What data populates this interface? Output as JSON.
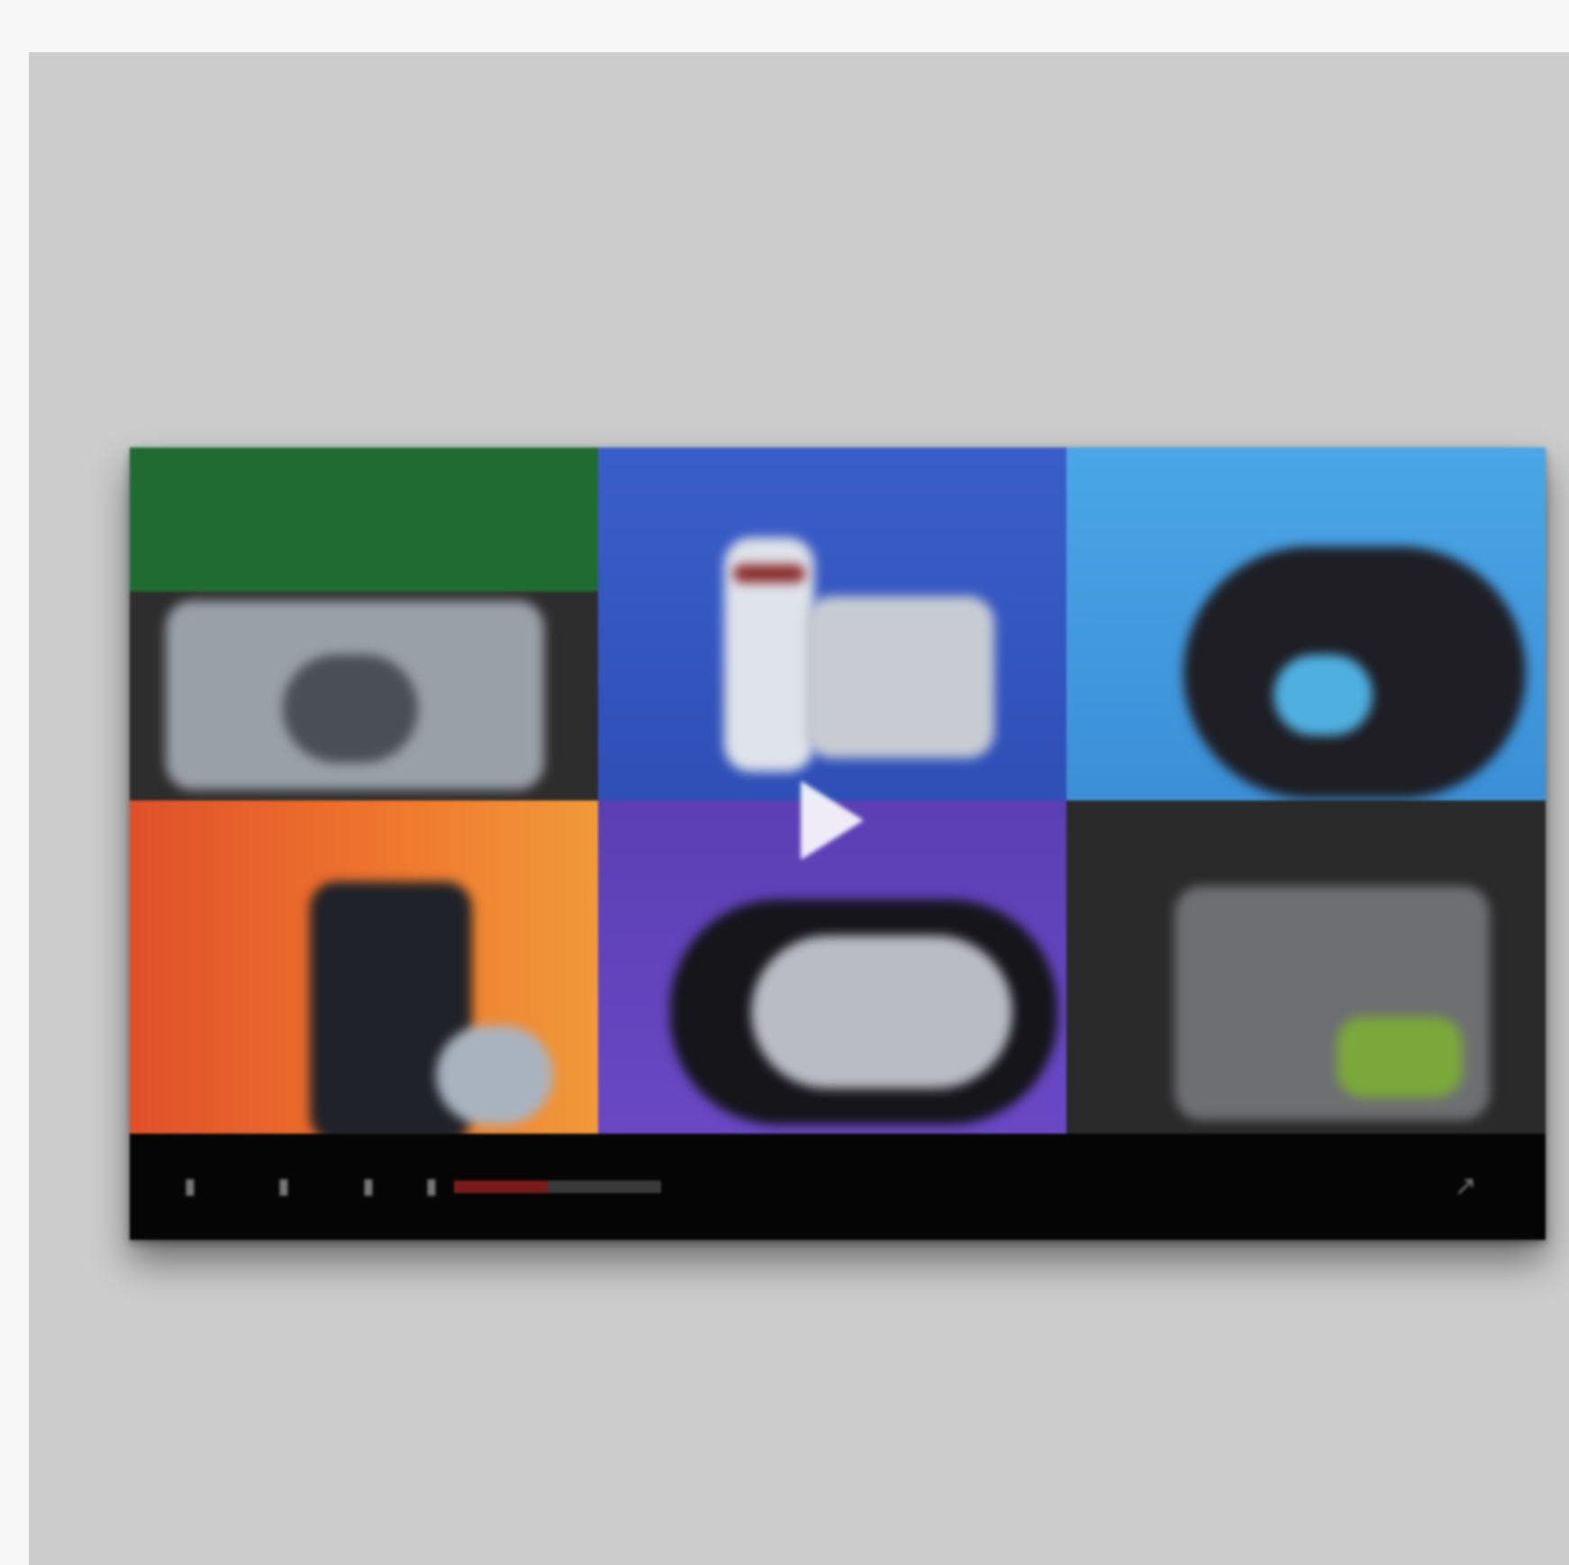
{
  "player": {
    "tiles": [
      {
        "title": "",
        "color": "#1f6b32"
      },
      {
        "title": "",
        "color": "#3a5ec9"
      },
      {
        "title": "",
        "color": "#4aa6e6"
      },
      {
        "title": "",
        "color": "#f07a2e"
      },
      {
        "title": "",
        "color": "#6a48c4"
      },
      {
        "title": "",
        "color": "#2a2a2a"
      }
    ],
    "controls": {
      "prev_icon": "previous-icon",
      "play_icon": "play-icon",
      "next_icon": "next-icon",
      "volume_icon": "volume-icon",
      "fullscreen_icon": "fullscreen-icon",
      "progress": 0.45,
      "progress_color": "#7a1c1c",
      "time_label": "",
      "quality_label": ""
    },
    "overlay_icon": "play-overlay-icon"
  }
}
